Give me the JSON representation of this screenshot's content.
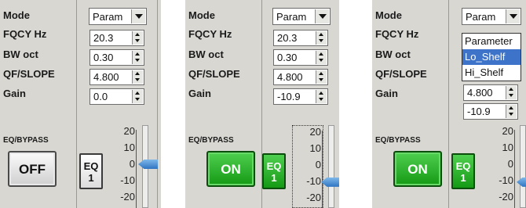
{
  "labels": {
    "mode": "Mode",
    "fqcy": "FQCY Hz",
    "bw": "BW oct",
    "qf": "QF/SLOPE",
    "gain": "Gain",
    "eq_bypass": "EQ/BYPASS"
  },
  "scale_ticks": [
    "20",
    "10",
    "0",
    "-10",
    "-20"
  ],
  "panels": [
    {
      "mode": "Param",
      "fqcy": "20.3",
      "bw": "0.30",
      "qf": "4.800",
      "gain": "0.0",
      "bypass": "OFF",
      "eq_top": "EQ",
      "eq_bottom": "1",
      "slider_db": 0
    },
    {
      "mode": "Param",
      "fqcy": "20.3",
      "bw": "0.30",
      "qf": "4.800",
      "gain": "-10.9",
      "bypass": "ON",
      "eq_top": "EQ",
      "eq_bottom": "1",
      "slider_db": -10.9
    },
    {
      "mode": "Param",
      "qf": "4.800",
      "gain": "-10.9",
      "bypass": "ON",
      "eq_top": "EQ",
      "eq_bottom": "1",
      "slider_db": -10.9,
      "dropdown": {
        "options": [
          "Parameter",
          "Lo_Shelf",
          "Hi_Shelf"
        ],
        "highlighted": "Lo_Shelf"
      }
    }
  ]
}
